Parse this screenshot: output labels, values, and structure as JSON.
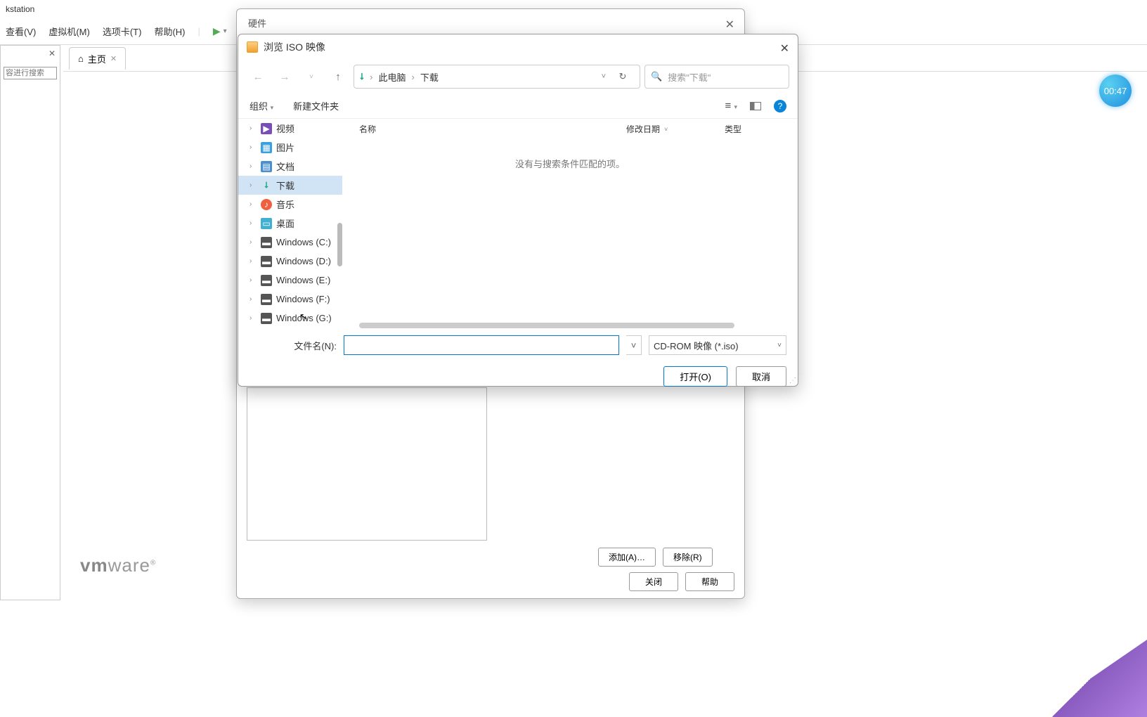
{
  "app": {
    "title": "kstation"
  },
  "menu": {
    "view": "查看(V)",
    "vm": "虚拟机(M)",
    "tabs": "选项卡(T)",
    "help": "帮助(H)"
  },
  "sidebar": {
    "search_placeholder": "容进行搜索"
  },
  "main_tab": {
    "label": "主页"
  },
  "logo": {
    "prefix": "vm",
    "suffix": "ware"
  },
  "hardware": {
    "title": "硬件",
    "add": "添加(A)…",
    "remove": "移除(R)",
    "close": "关闭",
    "help": "帮助"
  },
  "browse": {
    "title": "浏览 ISO 映像",
    "breadcrumb": {
      "root": "此电脑",
      "folder": "下载"
    },
    "search_placeholder": "搜索\"下载\"",
    "organize": "组织",
    "new_folder": "新建文件夹",
    "columns": {
      "name": "名称",
      "date": "修改日期",
      "type": "类型"
    },
    "empty": "没有与搜索条件匹配的项。",
    "tree": [
      {
        "label": "视频",
        "icon": "ic-video"
      },
      {
        "label": "图片",
        "icon": "ic-pic"
      },
      {
        "label": "文档",
        "icon": "ic-doc"
      },
      {
        "label": "下载",
        "icon": "ic-down",
        "selected": true
      },
      {
        "label": "音乐",
        "icon": "ic-music"
      },
      {
        "label": "桌面",
        "icon": "ic-desktop"
      },
      {
        "label": "Windows (C:)",
        "icon": "ic-drive"
      },
      {
        "label": "Windows (D:)",
        "icon": "ic-drive"
      },
      {
        "label": "Windows (E:)",
        "icon": "ic-drive"
      },
      {
        "label": "Windows (F:)",
        "icon": "ic-drive"
      },
      {
        "label": "Windows (G:)",
        "icon": "ic-drive"
      }
    ],
    "filename_label": "文件名(N):",
    "filename_value": "",
    "filetype": "CD-ROM 映像 (*.iso)",
    "open": "打开(O)",
    "cancel": "取消"
  },
  "timer": "00:47"
}
